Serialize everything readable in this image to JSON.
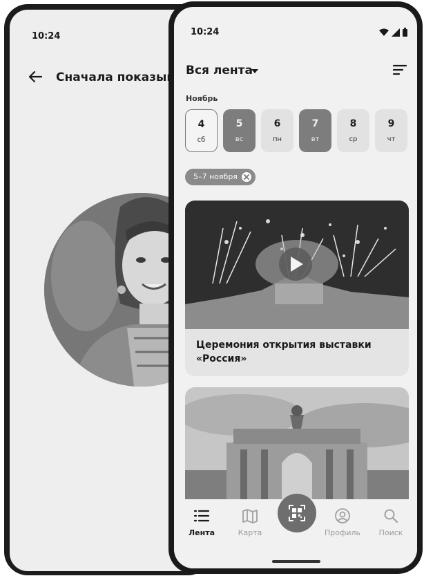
{
  "back_screen": {
    "time": "10:24",
    "title": "Сначала показыват"
  },
  "front_screen": {
    "time": "10:24",
    "header": {
      "title": "Вся лента"
    },
    "calendar": {
      "month": "Ноябрь",
      "days": [
        {
          "num": "4",
          "dow": "сб",
          "state": "selected"
        },
        {
          "num": "5",
          "dow": "вс",
          "state": "weekend"
        },
        {
          "num": "6",
          "dow": "пн",
          "state": "normal"
        },
        {
          "num": "7",
          "dow": "вт",
          "state": "weekend"
        },
        {
          "num": "8",
          "dow": "ср",
          "state": "normal"
        },
        {
          "num": "9",
          "dow": "чт",
          "state": "normal"
        }
      ]
    },
    "filter_chip": {
      "label": "5–7 ноября"
    },
    "cards": [
      {
        "title": "Церемония открытия выставки «Россия»",
        "image": "fireworks-photo",
        "has_video": true
      },
      {
        "title": "",
        "image": "arch-gate-photo",
        "has_video": false
      }
    ],
    "tabbar": {
      "items": [
        {
          "label": "Лента",
          "icon": "list-icon",
          "active": true
        },
        {
          "label": "Карта",
          "icon": "map-icon",
          "active": false
        },
        {
          "label": "",
          "icon": "qr-scan-icon",
          "active": false
        },
        {
          "label": "Профиль",
          "icon": "profile-icon",
          "active": false
        },
        {
          "label": "Поиск",
          "icon": "search-icon",
          "active": false
        }
      ]
    }
  }
}
